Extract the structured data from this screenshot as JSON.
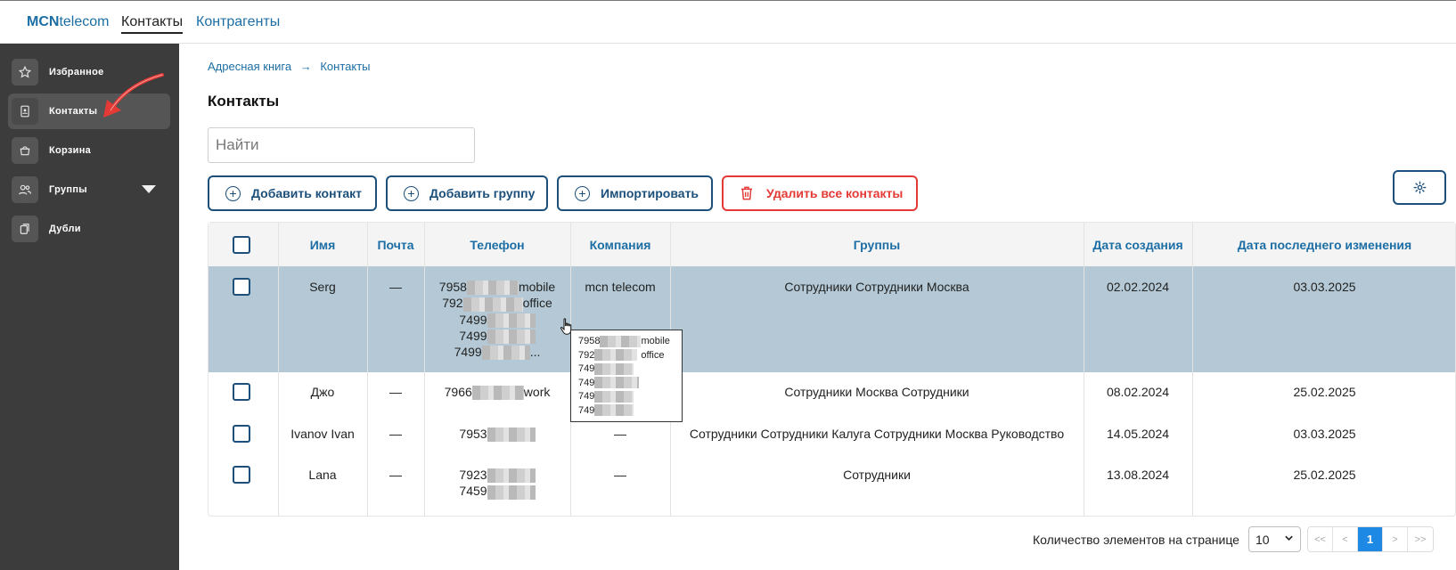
{
  "app": {
    "logo_bold": "MCN",
    "logo_rest": "telecom",
    "nav": [
      {
        "label": "Контакты",
        "active": true
      },
      {
        "label": "Контрагенты",
        "active": false
      }
    ]
  },
  "sidebar": {
    "items": [
      {
        "label": "Избранное",
        "icon": "star-icon"
      },
      {
        "label": "Контакты",
        "icon": "contact-card-icon"
      },
      {
        "label": "Корзина",
        "icon": "basket-icon"
      },
      {
        "label": "Группы",
        "icon": "users-icon"
      },
      {
        "label": "Дубли",
        "icon": "duplicates-icon"
      }
    ]
  },
  "breadcrumb": {
    "root": "Адресная книга",
    "current": "Контакты"
  },
  "page_title": "Контакты",
  "search": {
    "placeholder": "Найти",
    "value": ""
  },
  "toolbar": {
    "add_contact": "Добавить контакт",
    "add_group": "Добавить группу",
    "import": "Импортировать",
    "delete_all": "Удалить все контакты"
  },
  "table": {
    "columns": [
      "Имя",
      "Почта",
      "Телефон",
      "Компания",
      "Группы",
      "Дата создания",
      "Дата последнего изменения"
    ],
    "rows": [
      {
        "name": "Serg",
        "email": "—",
        "phones": [
          {
            "prefix": "7958",
            "type": "mobile"
          },
          {
            "prefix": "792",
            "type": "office"
          },
          {
            "prefix": "7499",
            "type": ""
          },
          {
            "prefix": "7499",
            "type": ""
          },
          {
            "prefix": "7499",
            "type": "..."
          }
        ],
        "company": "mcn telecom",
        "groups": "Сотрудники Сотрудники Москва",
        "created": "02.02.2024",
        "modified": "03.03.2025"
      },
      {
        "name": "Джо",
        "email": "—",
        "phones": [
          {
            "prefix": "7966",
            "type": "work"
          }
        ],
        "company": "",
        "groups": "Сотрудники Москва Сотрудники",
        "created": "08.02.2024",
        "modified": "25.02.2025"
      },
      {
        "name": "Ivanov Ivan",
        "email": "—",
        "phones": [
          {
            "prefix": "7953",
            "type": ""
          }
        ],
        "company": "—",
        "groups": "Сотрудники Сотрудники Калуга Сотрудники Москва Руководство",
        "created": "14.05.2024",
        "modified": "03.03.2025"
      },
      {
        "name": "Lana",
        "email": "—",
        "phones": [
          {
            "prefix": "7923",
            "type": ""
          },
          {
            "prefix": "7459",
            "type": ""
          }
        ],
        "company": "—",
        "groups": "Сотрудники",
        "created": "13.08.2024",
        "modified": "25.02.2025"
      }
    ]
  },
  "tooltip": {
    "lines": [
      {
        "prefix": "7958",
        "type": "mobile"
      },
      {
        "prefix": "792",
        "type": "office"
      },
      {
        "prefix": "749",
        "type": ""
      },
      {
        "prefix": "749",
        "type": ""
      },
      {
        "prefix": "749",
        "type": ""
      },
      {
        "prefix": "749",
        "type": ""
      }
    ]
  },
  "pagination": {
    "label": "Количество элементов на странице",
    "page_size": "10",
    "first": "<<",
    "prev": "<",
    "current": "1",
    "next": ">",
    "last": ">>"
  },
  "colors": {
    "accent": "#1c6ea4",
    "danger": "#e53935",
    "sidebar": "#3c3c3c",
    "selected_row": "#b4c9d5",
    "page_active": "#1e88e5"
  }
}
